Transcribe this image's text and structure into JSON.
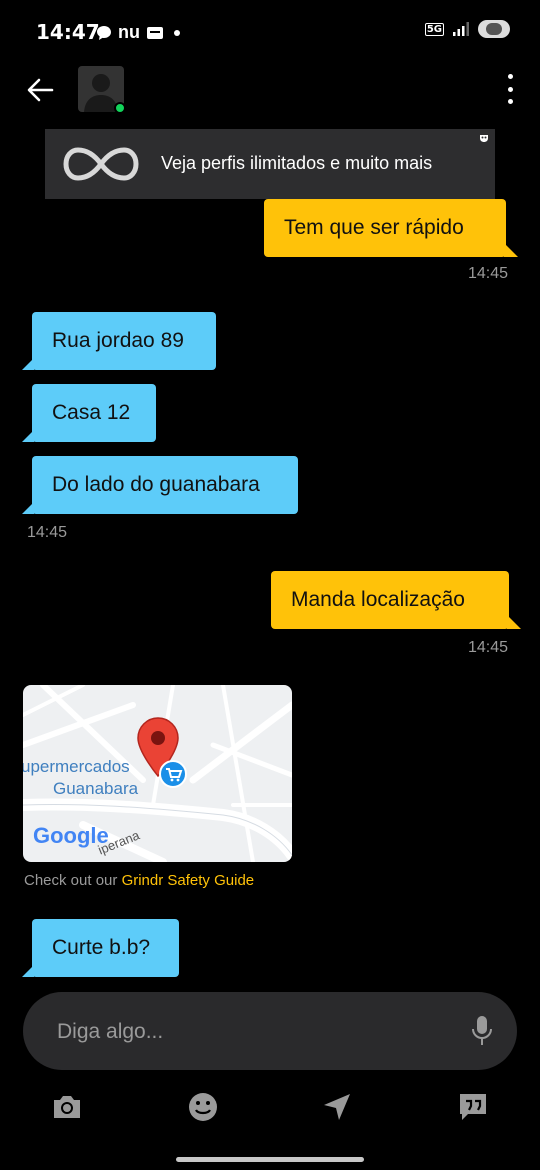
{
  "status_bar": {
    "time": "14:47",
    "app_icons": [
      "chat-bubble-icon",
      "nu",
      "wallet-icon",
      "dot"
    ],
    "nu_label": "nu",
    "network_label": "5G",
    "right_icons": [
      "5g-icon",
      "signal-icon",
      "battery-icon"
    ]
  },
  "header": {
    "back_icon": "arrow-left-icon",
    "menu_icon": "more-vertical-icon",
    "online": true
  },
  "banner": {
    "text": "Veja perfis ilimitados e muito mais",
    "icon": "infinity-icon"
  },
  "messages": [
    {
      "direction": "outgoing",
      "text": "Tem que ser rápido",
      "time": "14:45"
    },
    {
      "direction": "incoming",
      "text": "Rua jordao 89"
    },
    {
      "direction": "incoming",
      "text": "Casa 12"
    },
    {
      "direction": "incoming",
      "text": "Do lado do guanabara",
      "time": "14:45"
    },
    {
      "direction": "outgoing",
      "text": "Manda localização",
      "time": "14:45"
    },
    {
      "direction": "incoming",
      "text": "Curte b.b?"
    }
  ],
  "map": {
    "place_line1": "upermercados",
    "place_line2": "Guanabara",
    "street": "iperana",
    "logo": "Google"
  },
  "safety": {
    "prefix": "Check out our ",
    "link": "Grindr Safety Guide"
  },
  "composer": {
    "placeholder": "Diga algo...",
    "mic_icon": "microphone-icon"
  },
  "toolbar": {
    "icons": [
      "camera-icon",
      "emoji-icon",
      "location-arrow-icon",
      "saved-phrases-icon"
    ]
  },
  "colors": {
    "outgoing_bubble": "#ffc209",
    "incoming_bubble": "#5dccf9",
    "background": "#000000",
    "online": "#12d35a"
  }
}
